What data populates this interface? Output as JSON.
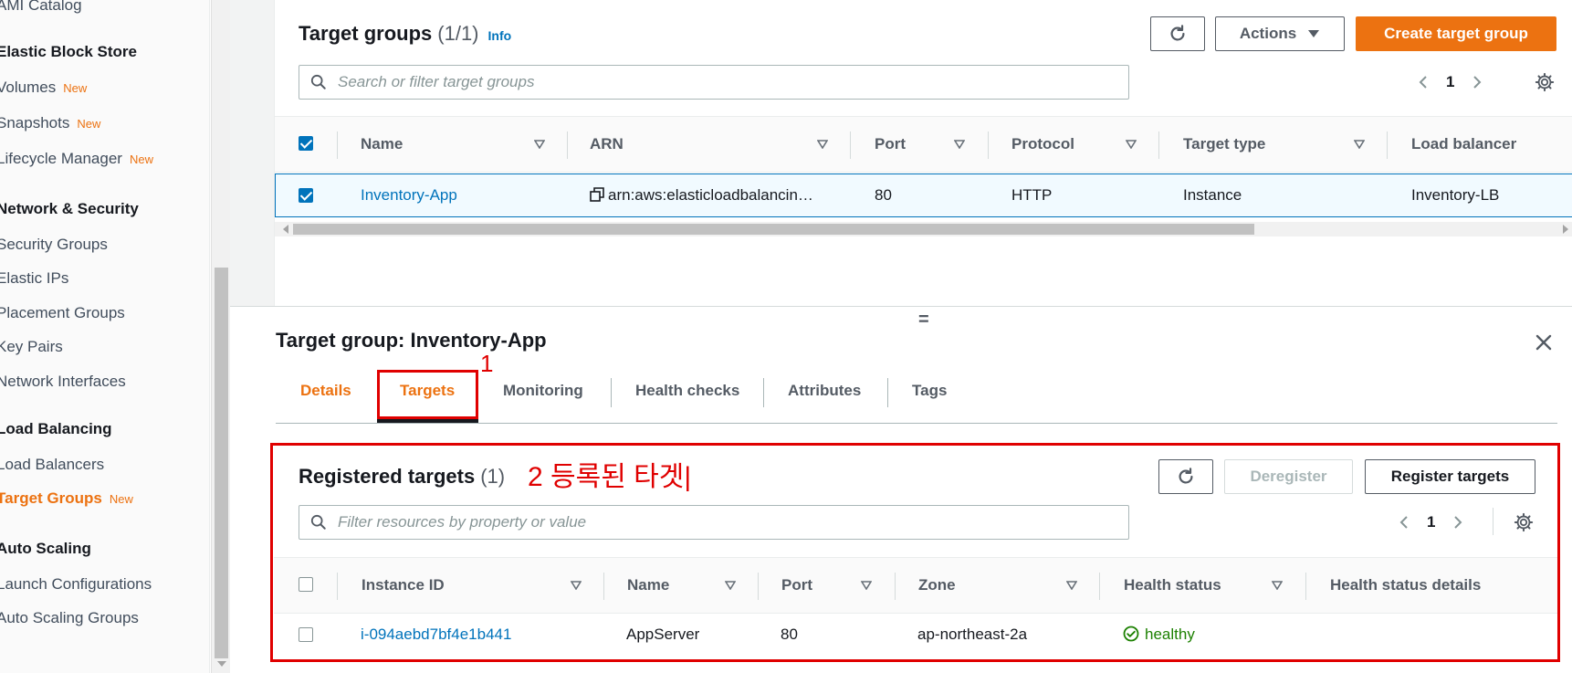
{
  "sidebar": {
    "items": [
      {
        "label": "AMI Catalog",
        "type": "item"
      },
      {
        "label": "Elastic Block Store",
        "type": "section"
      },
      {
        "label": "Volumes",
        "type": "item",
        "badge": "New"
      },
      {
        "label": "Snapshots",
        "type": "item",
        "badge": "New"
      },
      {
        "label": "Lifecycle Manager",
        "type": "item",
        "badge": "New"
      },
      {
        "label": "Network & Security",
        "type": "section"
      },
      {
        "label": "Security Groups",
        "type": "item"
      },
      {
        "label": "Elastic IPs",
        "type": "item"
      },
      {
        "label": "Placement Groups",
        "type": "item"
      },
      {
        "label": "Key Pairs",
        "type": "item"
      },
      {
        "label": "Network Interfaces",
        "type": "item"
      },
      {
        "label": "Load Balancing",
        "type": "section"
      },
      {
        "label": "Load Balancers",
        "type": "item"
      },
      {
        "label": "Target Groups",
        "type": "active",
        "badge": "New"
      },
      {
        "label": "Auto Scaling",
        "type": "section"
      },
      {
        "label": "Launch Configurations",
        "type": "item"
      },
      {
        "label": "Auto Scaling Groups",
        "type": "item"
      }
    ]
  },
  "target_groups": {
    "title": "Target groups",
    "count": "(1/1)",
    "info": "Info",
    "actions_label": "Actions",
    "create_label": "Create target group",
    "search_placeholder": "Search or filter target groups",
    "page": "1",
    "columns": [
      "Name",
      "ARN",
      "Port",
      "Protocol",
      "Target type",
      "Load balancer"
    ],
    "rows": [
      {
        "name": "Inventory-App",
        "arn": "arn:aws:elasticloadbalancin…",
        "port": "80",
        "protocol": "HTTP",
        "target_type": "Instance",
        "load_balancer": "Inventory-LB"
      }
    ]
  },
  "detail": {
    "title": "Target group: Inventory-App",
    "tabs": [
      "Details",
      "Targets",
      "Monitoring",
      "Health checks",
      "Attributes",
      "Tags"
    ],
    "active_tab": "Targets"
  },
  "annotations": {
    "label1": "1",
    "label2": "2 등록된 타겟|"
  },
  "registered": {
    "title": "Registered targets",
    "count": "(1)",
    "deregister_label": "Deregister",
    "register_label": "Register targets",
    "search_placeholder": "Filter resources by property or value",
    "page": "1",
    "columns": [
      "Instance ID",
      "Name",
      "Port",
      "Zone",
      "Health status",
      "Health status details"
    ],
    "rows": [
      {
        "instance_id": "i-094aebd7bf4e1b441",
        "name": "AppServer",
        "port": "80",
        "zone": "ap-northeast-2a",
        "health": "healthy",
        "details": ""
      }
    ]
  },
  "colors": {
    "accent": "#ec7211",
    "link": "#0073bb",
    "annotation": "#e00000",
    "healthy": "#1d8102"
  }
}
